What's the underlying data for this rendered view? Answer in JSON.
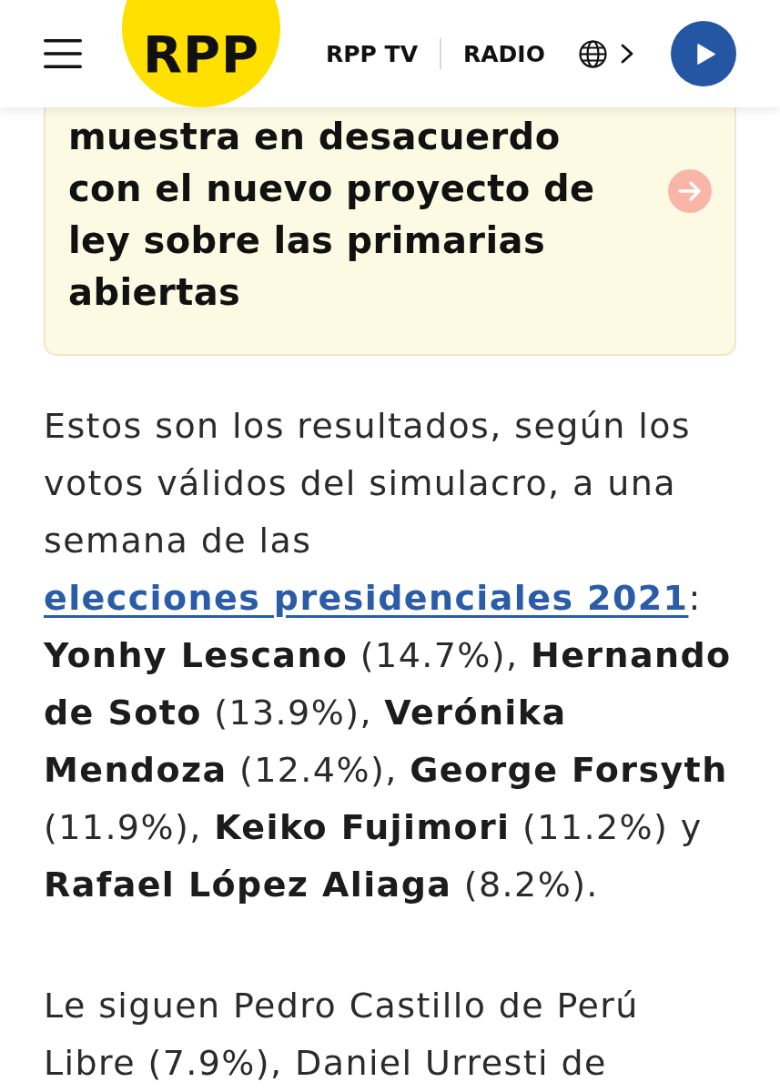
{
  "header": {
    "logo": "RPP",
    "nav_links": [
      {
        "label": "RPP TV"
      },
      {
        "label": "RADIO"
      }
    ]
  },
  "related_card": {
    "title": "muestra en desacuerdo con el nuevo proyecto de ley sobre las primarias abiertas"
  },
  "paragraphs": [
    {
      "text_before_link": "Estos son los resultados, según los votos válidos del simulacro, a una semana de las ",
      "link": "elecciones presidenciales 2021",
      "text_after_link": ": **Yonhy Lescano** (14.7%), **Hernando de Soto** (13.9%), **Verónika Mendoza** (12.4%), **George Forsyth** (11.9%), **Keiko Fujimori** (11.2%) y **Rafael López Aliaga** (8.2%)."
    },
    {
      "text_before_link": "Le siguen Pedro Castillo de Perú Libre (7.9%), Daniel Urresti de"
    }
  ]
}
